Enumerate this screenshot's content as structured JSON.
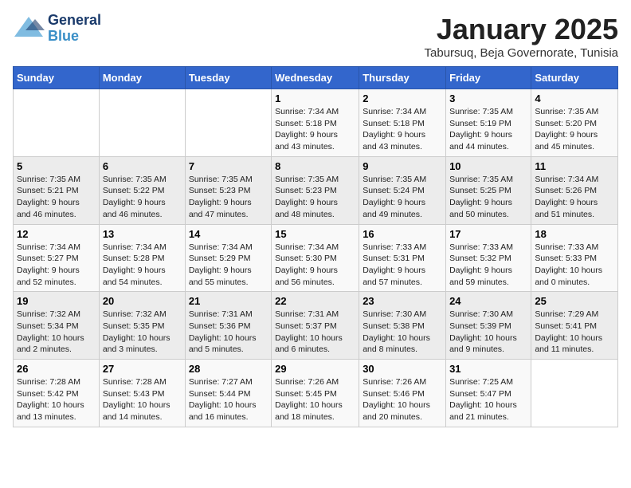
{
  "header": {
    "logo_general": "General",
    "logo_blue": "Blue",
    "month": "January 2025",
    "location": "Tabursuq, Beja Governorate, Tunisia"
  },
  "days_of_week": [
    "Sunday",
    "Monday",
    "Tuesday",
    "Wednesday",
    "Thursday",
    "Friday",
    "Saturday"
  ],
  "weeks": [
    [
      {
        "day": "",
        "info": ""
      },
      {
        "day": "",
        "info": ""
      },
      {
        "day": "",
        "info": ""
      },
      {
        "day": "1",
        "info": "Sunrise: 7:34 AM\nSunset: 5:18 PM\nDaylight: 9 hours\nand 43 minutes."
      },
      {
        "day": "2",
        "info": "Sunrise: 7:34 AM\nSunset: 5:18 PM\nDaylight: 9 hours\nand 43 minutes."
      },
      {
        "day": "3",
        "info": "Sunrise: 7:35 AM\nSunset: 5:19 PM\nDaylight: 9 hours\nand 44 minutes."
      },
      {
        "day": "4",
        "info": "Sunrise: 7:35 AM\nSunset: 5:20 PM\nDaylight: 9 hours\nand 45 minutes."
      }
    ],
    [
      {
        "day": "5",
        "info": "Sunrise: 7:35 AM\nSunset: 5:21 PM\nDaylight: 9 hours\nand 46 minutes."
      },
      {
        "day": "6",
        "info": "Sunrise: 7:35 AM\nSunset: 5:22 PM\nDaylight: 9 hours\nand 46 minutes."
      },
      {
        "day": "7",
        "info": "Sunrise: 7:35 AM\nSunset: 5:23 PM\nDaylight: 9 hours\nand 47 minutes."
      },
      {
        "day": "8",
        "info": "Sunrise: 7:35 AM\nSunset: 5:23 PM\nDaylight: 9 hours\nand 48 minutes."
      },
      {
        "day": "9",
        "info": "Sunrise: 7:35 AM\nSunset: 5:24 PM\nDaylight: 9 hours\nand 49 minutes."
      },
      {
        "day": "10",
        "info": "Sunrise: 7:35 AM\nSunset: 5:25 PM\nDaylight: 9 hours\nand 50 minutes."
      },
      {
        "day": "11",
        "info": "Sunrise: 7:34 AM\nSunset: 5:26 PM\nDaylight: 9 hours\nand 51 minutes."
      }
    ],
    [
      {
        "day": "12",
        "info": "Sunrise: 7:34 AM\nSunset: 5:27 PM\nDaylight: 9 hours\nand 52 minutes."
      },
      {
        "day": "13",
        "info": "Sunrise: 7:34 AM\nSunset: 5:28 PM\nDaylight: 9 hours\nand 54 minutes."
      },
      {
        "day": "14",
        "info": "Sunrise: 7:34 AM\nSunset: 5:29 PM\nDaylight: 9 hours\nand 55 minutes."
      },
      {
        "day": "15",
        "info": "Sunrise: 7:34 AM\nSunset: 5:30 PM\nDaylight: 9 hours\nand 56 minutes."
      },
      {
        "day": "16",
        "info": "Sunrise: 7:33 AM\nSunset: 5:31 PM\nDaylight: 9 hours\nand 57 minutes."
      },
      {
        "day": "17",
        "info": "Sunrise: 7:33 AM\nSunset: 5:32 PM\nDaylight: 9 hours\nand 59 minutes."
      },
      {
        "day": "18",
        "info": "Sunrise: 7:33 AM\nSunset: 5:33 PM\nDaylight: 10 hours\nand 0 minutes."
      }
    ],
    [
      {
        "day": "19",
        "info": "Sunrise: 7:32 AM\nSunset: 5:34 PM\nDaylight: 10 hours\nand 2 minutes."
      },
      {
        "day": "20",
        "info": "Sunrise: 7:32 AM\nSunset: 5:35 PM\nDaylight: 10 hours\nand 3 minutes."
      },
      {
        "day": "21",
        "info": "Sunrise: 7:31 AM\nSunset: 5:36 PM\nDaylight: 10 hours\nand 5 minutes."
      },
      {
        "day": "22",
        "info": "Sunrise: 7:31 AM\nSunset: 5:37 PM\nDaylight: 10 hours\nand 6 minutes."
      },
      {
        "day": "23",
        "info": "Sunrise: 7:30 AM\nSunset: 5:38 PM\nDaylight: 10 hours\nand 8 minutes."
      },
      {
        "day": "24",
        "info": "Sunrise: 7:30 AM\nSunset: 5:39 PM\nDaylight: 10 hours\nand 9 minutes."
      },
      {
        "day": "25",
        "info": "Sunrise: 7:29 AM\nSunset: 5:41 PM\nDaylight: 10 hours\nand 11 minutes."
      }
    ],
    [
      {
        "day": "26",
        "info": "Sunrise: 7:28 AM\nSunset: 5:42 PM\nDaylight: 10 hours\nand 13 minutes."
      },
      {
        "day": "27",
        "info": "Sunrise: 7:28 AM\nSunset: 5:43 PM\nDaylight: 10 hours\nand 14 minutes."
      },
      {
        "day": "28",
        "info": "Sunrise: 7:27 AM\nSunset: 5:44 PM\nDaylight: 10 hours\nand 16 minutes."
      },
      {
        "day": "29",
        "info": "Sunrise: 7:26 AM\nSunset: 5:45 PM\nDaylight: 10 hours\nand 18 minutes."
      },
      {
        "day": "30",
        "info": "Sunrise: 7:26 AM\nSunset: 5:46 PM\nDaylight: 10 hours\nand 20 minutes."
      },
      {
        "day": "31",
        "info": "Sunrise: 7:25 AM\nSunset: 5:47 PM\nDaylight: 10 hours\nand 21 minutes."
      },
      {
        "day": "",
        "info": ""
      }
    ]
  ]
}
